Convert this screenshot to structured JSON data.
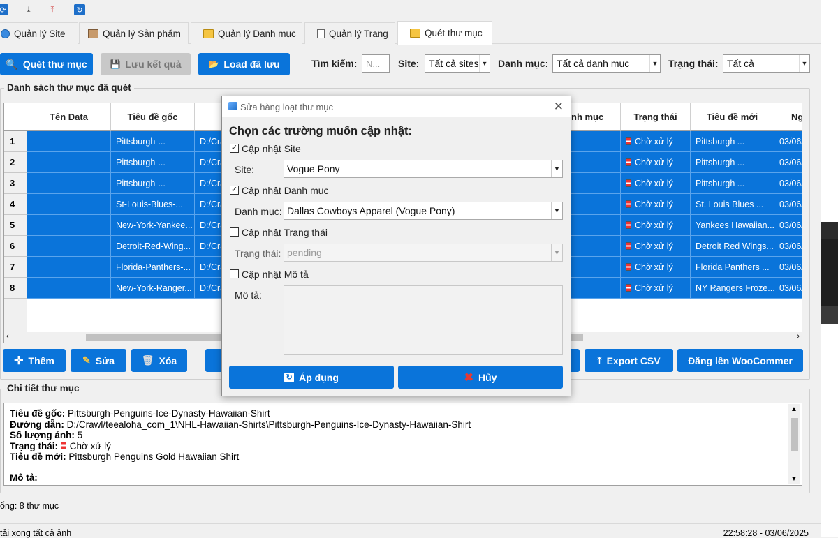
{
  "toolbar": {
    "icons": [
      "refresh-icon",
      "download-icon",
      "upload-icon",
      "sync-icon"
    ]
  },
  "tabs": [
    {
      "label": "Quản lý Site",
      "icon": "globe-icon"
    },
    {
      "label": "Quản lý Sản phẩm",
      "icon": "box-icon"
    },
    {
      "label": "Quản lý Danh mục",
      "icon": "folder-icon"
    },
    {
      "label": "Quản lý Trang",
      "icon": "document-icon"
    },
    {
      "label": "Quét thư mục",
      "icon": "folder-icon",
      "active": true
    }
  ],
  "actions": {
    "scan": "Quét thư mục",
    "save": "Lưu kết quả",
    "load": "Load đã lưu"
  },
  "filters": {
    "search_label": "Tìm kiếm:",
    "search_placeholder": "N...",
    "site_label": "Site:",
    "site_value": "Tất cả sites",
    "category_label": "Danh mục:",
    "category_value": "Tất cả danh mục",
    "status_label": "Trạng thái:",
    "status_value": "Tất cả"
  },
  "list_group_title": "Danh sách thư mục đã quét",
  "grid": {
    "columns": [
      "Tên Data",
      "Tiêu đề gốc",
      "",
      "nh mục",
      "Trạng thái",
      "Tiêu đề mới",
      "Ng"
    ],
    "rows": [
      {
        "num": "1",
        "name": "",
        "orig": "Pittsburgh-...",
        "path": "D:/Cra",
        "status": "Chờ xử lý",
        "newtitle": "Pittsburgh ...",
        "date": "03/06/"
      },
      {
        "num": "2",
        "name": "",
        "orig": "Pittsburgh-...",
        "path": "D:/Cra",
        "status": "Chờ xử lý",
        "newtitle": "Pittsburgh ...",
        "date": "03/06/"
      },
      {
        "num": "3",
        "name": "",
        "orig": "Pittsburgh-...",
        "path": "D:/Cra",
        "status": "Chờ xử lý",
        "newtitle": "Pittsburgh ...",
        "date": "03/06/"
      },
      {
        "num": "4",
        "name": "",
        "orig": "St-Louis-Blues-...",
        "path": "D:/Cra",
        "status": "Chờ xử lý",
        "newtitle": "St. Louis Blues ...",
        "date": "03/06/"
      },
      {
        "num": "5",
        "name": "",
        "orig": "New-York-Yankee...",
        "path": "D:/Cra",
        "status": "Chờ xử lý",
        "newtitle": "Yankees Hawaiian...",
        "date": "03/06/"
      },
      {
        "num": "6",
        "name": "",
        "orig": "Detroit-Red-Wing...",
        "path": "D:/Cra",
        "status": "Chờ xử lý",
        "newtitle": "Detroit Red Wings...",
        "date": "03/06/"
      },
      {
        "num": "7",
        "name": "",
        "orig": "Florida-Panthers-...",
        "path": "D:/Cra",
        "status": "Chờ xử lý",
        "newtitle": "Florida Panthers ...",
        "date": "03/06/"
      },
      {
        "num": "8",
        "name": "",
        "orig": "New-York-Ranger...",
        "path": "D:/Cra",
        "status": "Chờ xử lý",
        "newtitle": "NY Rangers Froze...",
        "date": "03/06/"
      }
    ]
  },
  "row_actions": {
    "add": "Thêm",
    "edit": "Sửa",
    "delete": "Xóa",
    "export": "Export CSV",
    "publish": "Đăng lên WooCommer"
  },
  "detail_group_title": "Chi tiết thư mục",
  "detail": {
    "orig_label": "Tiêu đề gốc:",
    "orig_value": "Pittsburgh-Penguins-Ice-Dynasty-Hawaiian-Shirt",
    "path_label": "Đường dẫn:",
    "path_value": "D:/Crawl/teealoha_com_1\\NHL-Hawaiian-Shirts\\Pittsburgh-Penguins-Ice-Dynasty-Hawaiian-Shirt",
    "count_label": "Số lượng ảnh:",
    "count_value": "5",
    "status_label": "Trạng thái:",
    "status_value": "Chờ xử lý",
    "newtitle_label": "Tiêu đề mới:",
    "newtitle_value": "Pittsburgh Penguins Gold Hawaiian Shirt",
    "desc_label": "Mô tả:"
  },
  "totals": "ổng: 8 thư mục",
  "statusbar": {
    "left": "tải xong tất cả ảnh",
    "right": "22:58:28 - 03/06/2025"
  },
  "modal": {
    "title": "Sửa hàng loạt thư mục",
    "heading": "Chọn các trường muốn cập nhật:",
    "site_check": "Cập nhật Site",
    "site_checked": true,
    "site_label": "Site:",
    "site_value": "Vogue Pony",
    "cat_check": "Cập nhật Danh mục",
    "cat_checked": true,
    "cat_label": "Danh mục:",
    "cat_value": "Dallas Cowboys Apparel (Vogue Pony)",
    "status_check": "Cập nhật Trạng thái",
    "status_checked": false,
    "status_label": "Trạng thái:",
    "status_value": "pending",
    "desc_check": "Cập nhật Mô tả",
    "desc_checked": false,
    "desc_label": "Mô tả:",
    "apply": "Áp dụng",
    "cancel": "Hủy"
  },
  "colors": {
    "accent": "#0a74da",
    "selection": "#0a74da",
    "disabled_button": "#c8c8c8"
  }
}
